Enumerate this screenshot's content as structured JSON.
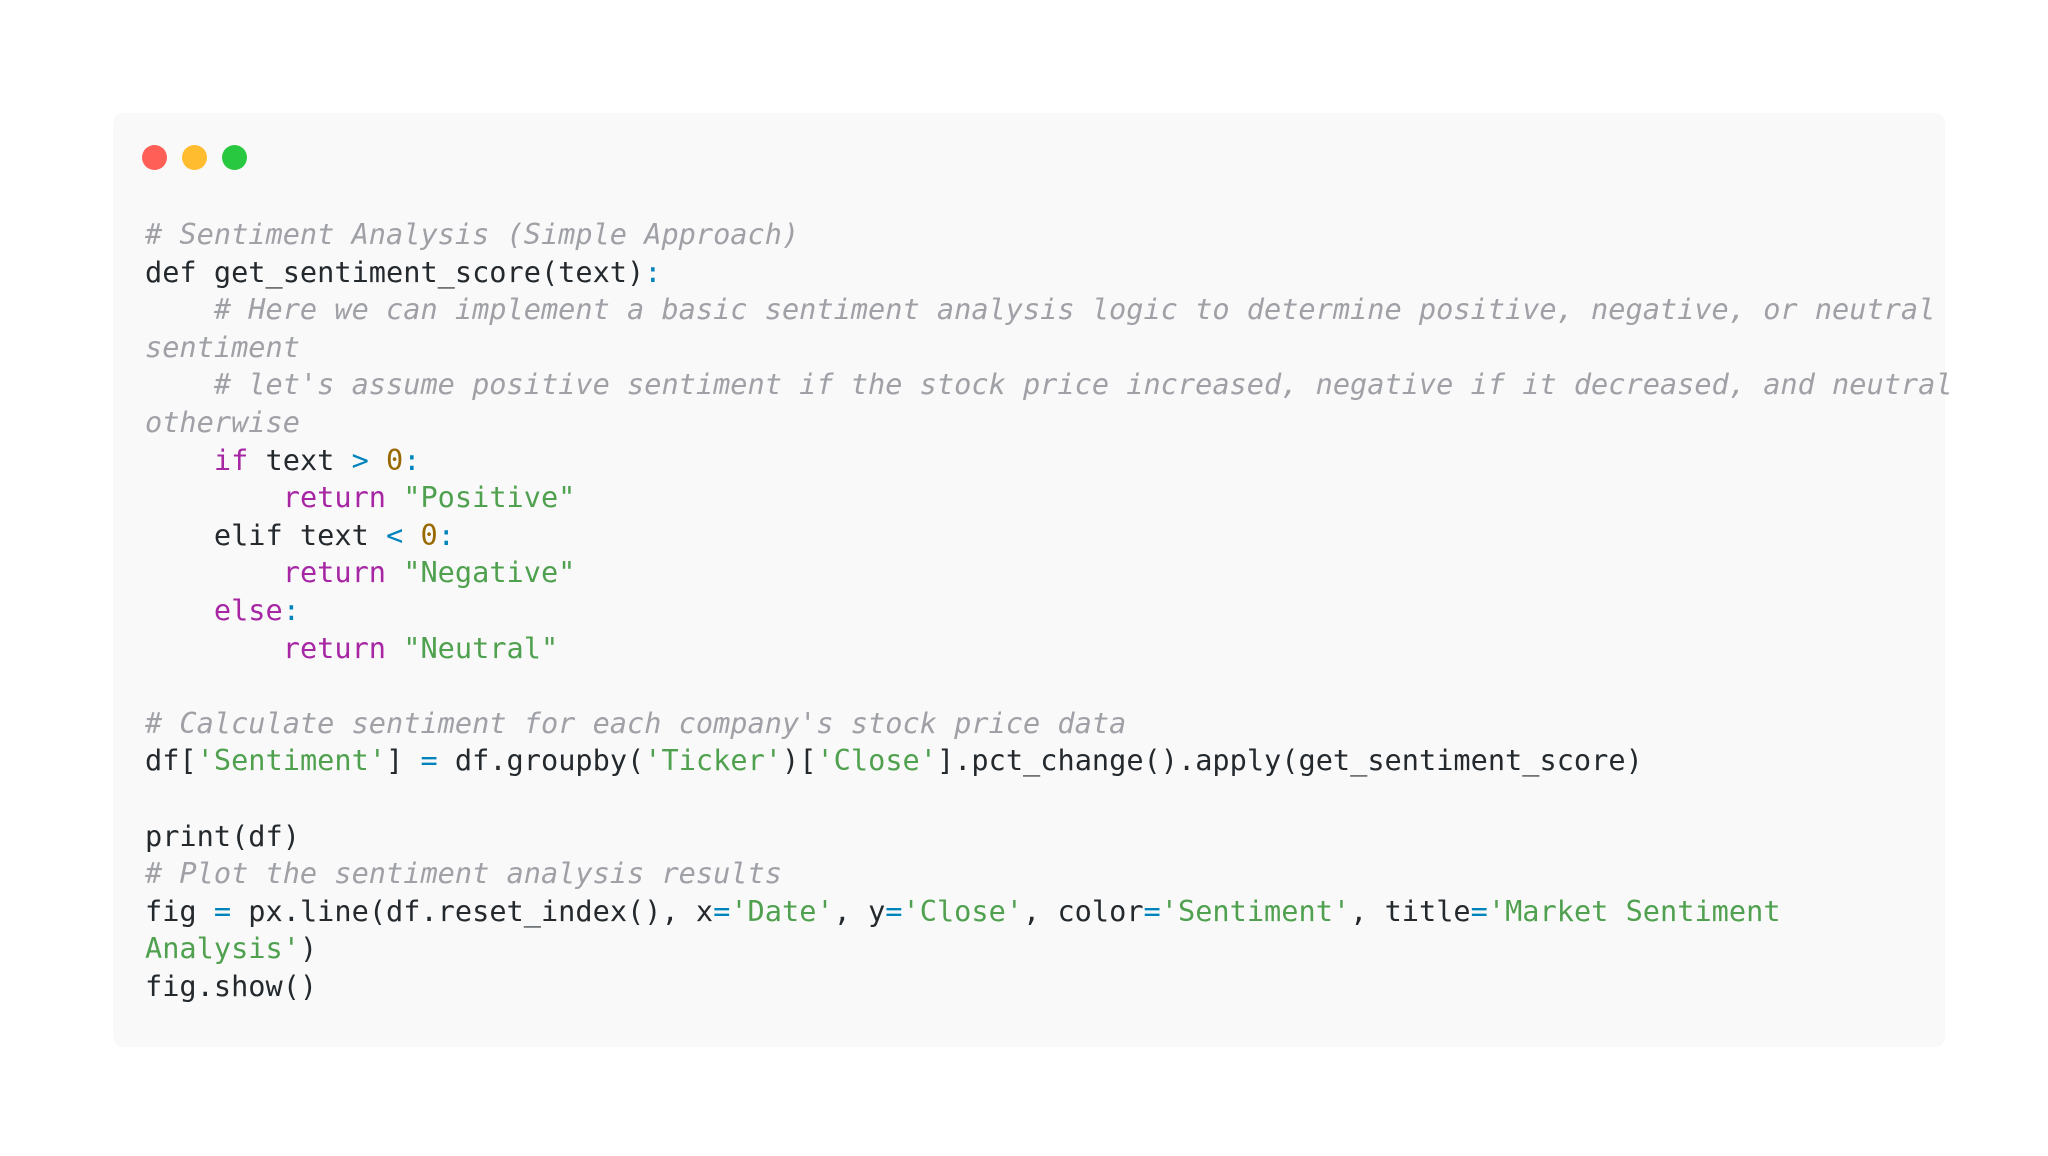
{
  "window": {
    "controls": [
      {
        "name": "close-button",
        "color": "#ff5f57"
      },
      {
        "name": "minimize-button",
        "color": "#febc2e"
      },
      {
        "name": "maximize-button",
        "color": "#28c840"
      }
    ]
  },
  "colors": {
    "background": "#f9f9f9",
    "comment": "#a0a1a7",
    "keyword": "#a626a4",
    "string": "#50a14f",
    "number": "#986801",
    "operator": "#0184bc",
    "plain": "#24292e"
  },
  "code": {
    "language": "python",
    "lines": [
      [
        [
          "comment",
          "# Sentiment Analysis (Simple Approach)"
        ]
      ],
      [
        [
          "plain",
          "def get_sentiment_score(text)"
        ],
        [
          "operator",
          ":"
        ]
      ],
      [
        [
          "comment",
          "    # Here we can implement a basic sentiment analysis logic to determine positive, negative, or neutral"
        ]
      ],
      [
        [
          "comment",
          "sentiment"
        ]
      ],
      [
        [
          "comment",
          "    # let's assume positive sentiment if the stock price increased, negative if it decreased, and neutral"
        ]
      ],
      [
        [
          "comment",
          "otherwise"
        ]
      ],
      [
        [
          "plain",
          "    "
        ],
        [
          "keyword",
          "if"
        ],
        [
          "plain",
          " text "
        ],
        [
          "operator",
          ">"
        ],
        [
          "plain",
          " "
        ],
        [
          "number",
          "0"
        ],
        [
          "operator",
          ":"
        ]
      ],
      [
        [
          "plain",
          "        "
        ],
        [
          "keyword",
          "return"
        ],
        [
          "plain",
          " "
        ],
        [
          "string",
          "\"Positive\""
        ]
      ],
      [
        [
          "plain",
          "    elif text "
        ],
        [
          "operator",
          "<"
        ],
        [
          "plain",
          " "
        ],
        [
          "number",
          "0"
        ],
        [
          "operator",
          ":"
        ]
      ],
      [
        [
          "plain",
          "        "
        ],
        [
          "keyword",
          "return"
        ],
        [
          "plain",
          " "
        ],
        [
          "string",
          "\"Negative\""
        ]
      ],
      [
        [
          "plain",
          "    "
        ],
        [
          "keyword",
          "else"
        ],
        [
          "operator",
          ":"
        ]
      ],
      [
        [
          "plain",
          "        "
        ],
        [
          "keyword",
          "return"
        ],
        [
          "plain",
          " "
        ],
        [
          "string",
          "\"Neutral\""
        ]
      ],
      [],
      [
        [
          "comment",
          "# Calculate sentiment for each company's stock price data"
        ]
      ],
      [
        [
          "plain",
          "df["
        ],
        [
          "string",
          "'Sentiment'"
        ],
        [
          "plain",
          "] "
        ],
        [
          "operator",
          "="
        ],
        [
          "plain",
          " df.groupby("
        ],
        [
          "string",
          "'Ticker'"
        ],
        [
          "plain",
          ")["
        ],
        [
          "string",
          "'Close'"
        ],
        [
          "plain",
          "].pct_change().apply(get_sentiment_score)"
        ]
      ],
      [],
      [
        [
          "plain",
          "print(df)"
        ]
      ],
      [
        [
          "comment",
          "# Plot the sentiment analysis results"
        ]
      ],
      [
        [
          "plain",
          "fig "
        ],
        [
          "operator",
          "="
        ],
        [
          "plain",
          " px.line(df.reset_index(), x"
        ],
        [
          "operator",
          "="
        ],
        [
          "string",
          "'Date'"
        ],
        [
          "plain",
          ", y"
        ],
        [
          "operator",
          "="
        ],
        [
          "string",
          "'Close'"
        ],
        [
          "plain",
          ", color"
        ],
        [
          "operator",
          "="
        ],
        [
          "string",
          "'Sentiment'"
        ],
        [
          "plain",
          ", title"
        ],
        [
          "operator",
          "="
        ],
        [
          "string",
          "'Market Sentiment"
        ]
      ],
      [
        [
          "string",
          "Analysis'"
        ],
        [
          "plain",
          ")"
        ]
      ],
      [
        [
          "plain",
          "fig.show()"
        ]
      ]
    ]
  }
}
